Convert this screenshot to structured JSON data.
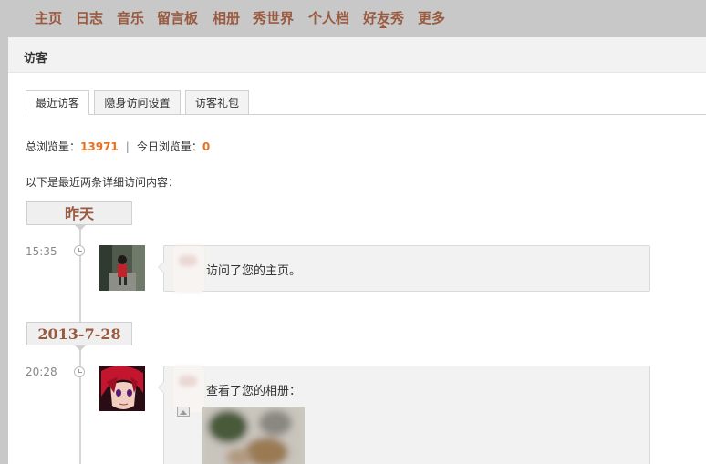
{
  "nav": {
    "items": [
      "主页",
      "日志",
      "音乐",
      "留言板",
      "相册",
      "秀世界",
      "个人档",
      "好友秀",
      "更多"
    ]
  },
  "panel": {
    "title": "访客"
  },
  "tabs": [
    "最近访客",
    "隐身访问设置",
    "访客礼包"
  ],
  "stats": {
    "total_label": "总浏览量：",
    "total_value": "13971",
    "separator": "|",
    "today_label": "今日浏览量：",
    "today_value": "0"
  },
  "intro": "以下是最近两条详细访问内容：",
  "timeline": [
    {
      "date": "昨天",
      "time": "15:35",
      "action": "访问了您的主页。",
      "icon": "clock-icon"
    },
    {
      "date": "2013-7-28",
      "time": "20:28",
      "action": "查看了您的相册：",
      "icon": "image-icon"
    }
  ],
  "colors": {
    "nav_text": "#9a5a40",
    "accent_number": "#e8701e",
    "topbar_bg": "#c8c8c8"
  }
}
